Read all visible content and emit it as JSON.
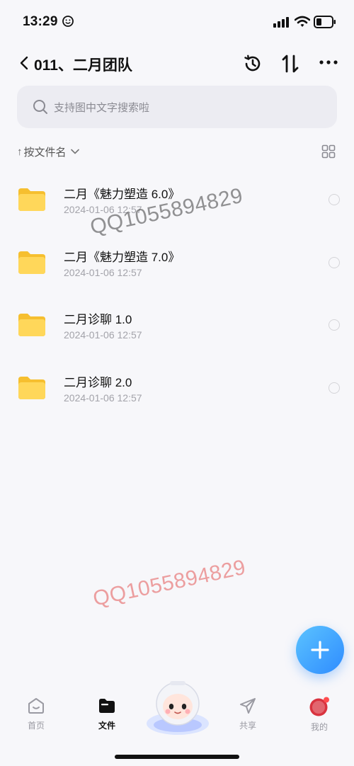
{
  "status_bar": {
    "time": "13:29"
  },
  "header": {
    "title": "011、二月团队",
    "back_icon": "chevron-left-icon",
    "actions": [
      "history-icon",
      "sort-arrows-icon",
      "more-icon"
    ]
  },
  "search": {
    "placeholder": "支持图中文字搜索啦"
  },
  "sort": {
    "arrow": "↑",
    "label": "按文件名"
  },
  "files": [
    {
      "name": "二月《魅力塑造 6.0》",
      "date": "2024-01-06 12:57"
    },
    {
      "name": "二月《魅力塑造 7.0》",
      "date": "2024-01-06 12:57"
    },
    {
      "name": "二月诊聊 1.0",
      "date": "2024-01-06 12:57"
    },
    {
      "name": "二月诊聊 2.0",
      "date": "2024-01-06 12:57"
    }
  ],
  "watermarks": [
    "QQ1055894829",
    "QQ1055894829"
  ],
  "tabs": [
    {
      "label": "首页",
      "icon": "home-icon",
      "active": false
    },
    {
      "label": "文件",
      "icon": "folder-icon",
      "active": true
    },
    {
      "label": "共享",
      "icon": "send-icon",
      "active": false
    },
    {
      "label": "我的",
      "icon": "avatar-icon",
      "active": false
    }
  ],
  "colors": {
    "background": "#f7f7fa",
    "search_bg": "#ececf2",
    "folder": "#ffd24d",
    "fab": "#3a9bff",
    "watermark_red": "#e66e6e"
  }
}
